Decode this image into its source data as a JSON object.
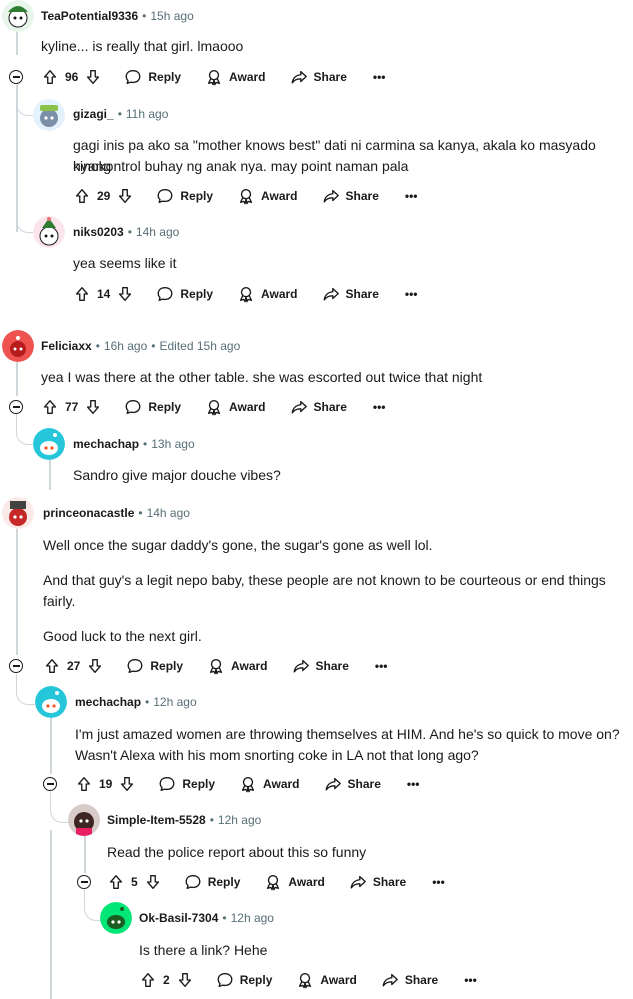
{
  "labels": {
    "reply": "Reply",
    "award": "Award",
    "share": "Share",
    "more": "•••"
  },
  "comments": [
    {
      "user": "TeaPotential9336",
      "time": "15h ago",
      "edited": "",
      "lines": [
        "kyline... is really that girl. lmaooo"
      ],
      "votes": "96",
      "avatar_color": "#2e7d32"
    },
    {
      "user": "gizagi_",
      "time": "11h ago",
      "edited": "",
      "lines": [
        "gagi inis pa ako sa \"mother knows best\" dati ni carmina sa kanya, akala ko masyado nyang",
        "kinokontrol buhay ng anak nya. may point naman pala"
      ],
      "votes": "29",
      "avatar_color": "#7b8fa8"
    },
    {
      "user": "niks0203",
      "time": "14h ago",
      "edited": "",
      "lines": [
        "yea seems like it"
      ],
      "votes": "14",
      "avatar_color": "#e57373"
    },
    {
      "user": "Feliciaxx",
      "time": "16h ago",
      "edited": "Edited 15h ago",
      "lines": [
        "yea I was there at the other table. she was escorted out twice that night"
      ],
      "votes": "77",
      "avatar_color": "#ef5350"
    },
    {
      "user": "mechachap",
      "time": "13h ago",
      "edited": "",
      "lines": [
        "Sandro give major douche vibes?"
      ],
      "votes": "",
      "avatar_color": "#26c6da"
    },
    {
      "user": "princeonacastle",
      "time": "14h ago",
      "edited": "",
      "lines": [
        "Well once the sugar daddy's gone, the sugar's gone as well lol.",
        "And that guy's a legit nepo baby, these people are not known to be courteous or end things",
        "fairly.",
        "Good luck to the next girl."
      ],
      "votes": "27",
      "avatar_color": "#c62828"
    },
    {
      "user": "mechachap",
      "time": "12h ago",
      "edited": "",
      "lines": [
        "I'm just amazed women are throwing themselves at HIM. And he's so quick to move on?",
        "Wasn't Alexa with his mom snorting coke in LA not that long ago?"
      ],
      "votes": "19",
      "avatar_color": "#26c6da"
    },
    {
      "user": "Simple-Item-5528",
      "time": "12h ago",
      "edited": "",
      "lines": [
        "Read the police report about this so funny"
      ],
      "votes": "5",
      "avatar_color": "#3e2723"
    },
    {
      "user": "Ok-Basil-7304",
      "time": "12h ago",
      "edited": "",
      "lines": [
        "Is there a link? Hehe"
      ],
      "votes": "2",
      "avatar_color": "#00e676"
    }
  ]
}
